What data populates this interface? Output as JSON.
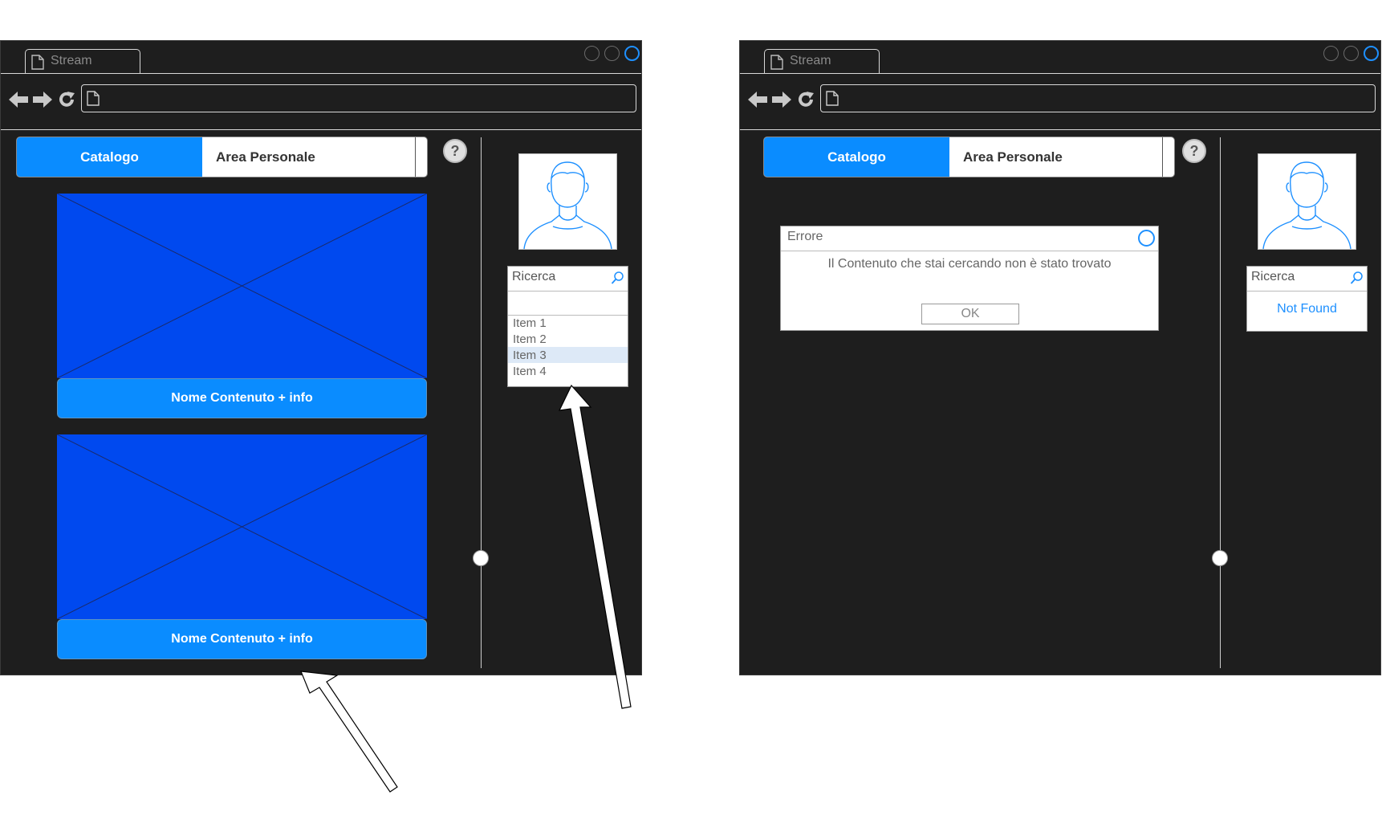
{
  "windows": [
    {
      "tab_title": "Stream",
      "tabs": {
        "active": "Catalogo",
        "inactive": "Area Personale"
      },
      "help": "?",
      "cards": [
        {
          "label": "Nome Contenuto + info"
        },
        {
          "label": "Nome Contenuto + info"
        }
      ],
      "search": {
        "label": "Ricerca",
        "items": [
          "Item 1",
          "Item 2",
          "Item 3",
          "Item 4"
        ],
        "selected": "Item 3"
      }
    },
    {
      "tab_title": "Stream",
      "tabs": {
        "active": "Catalogo",
        "inactive": "Area Personale"
      },
      "help": "?",
      "dialog": {
        "title": "Errore",
        "message": "Il Contenuto che stai cercando non è stato trovato",
        "ok": "OK"
      },
      "search": {
        "label": "Ricerca",
        "result": "Not Found"
      }
    }
  ],
  "colors": {
    "window_bg": "#1e1e1e",
    "accent": "#0a8cff",
    "placeholder_blue": "#0049ef",
    "link_blue": "#1e90ff"
  }
}
